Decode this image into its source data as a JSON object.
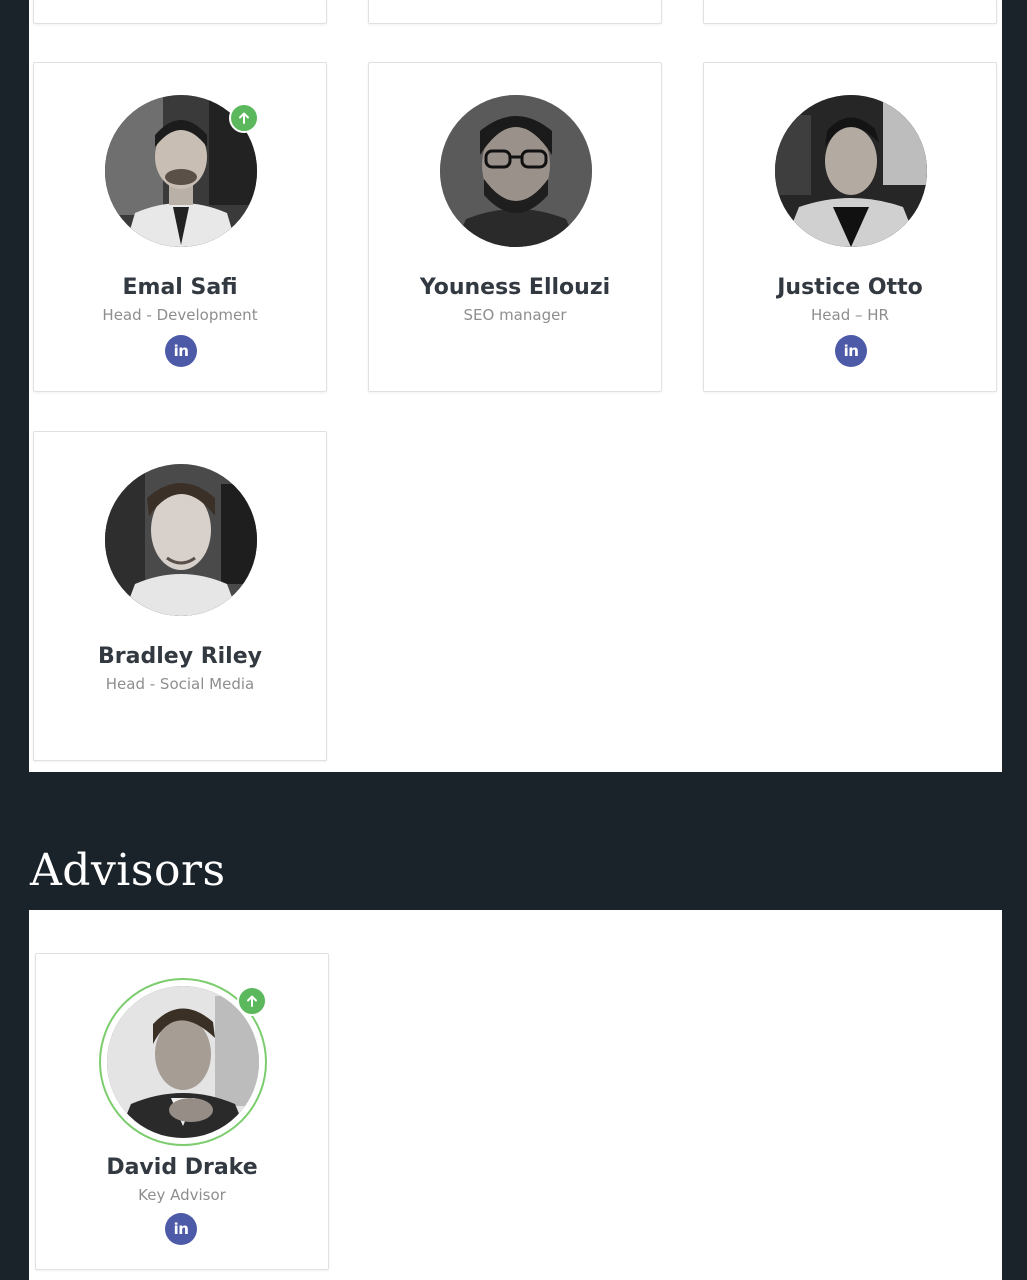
{
  "team": {
    "members": [
      {
        "name": "Emal Safi",
        "role": "Head - Development",
        "badge": "arrow-up-icon",
        "social": {
          "network": "linkedin",
          "glyph": "in"
        }
      },
      {
        "name": "Youness Ellouzi",
        "role": "SEO manager"
      },
      {
        "name": "Justice Otto",
        "role": "Head – HR",
        "social": {
          "network": "linkedin",
          "glyph": "in"
        }
      },
      {
        "name": "Bradley Riley",
        "role": "Head - Social Media"
      }
    ]
  },
  "advisors": {
    "heading": "Advisors",
    "members": [
      {
        "name": "David Drake",
        "role": "Key Advisor",
        "badge": "arrow-up-icon",
        "social": {
          "network": "linkedin",
          "glyph": "in"
        }
      }
    ]
  },
  "colors": {
    "page_background": "#1a232a",
    "panel_background": "#ffffff",
    "badge_green": "#5cb85c",
    "linkedin_purple": "#4c5aa8",
    "name_text": "#333940",
    "role_text": "#8e8e8e"
  }
}
